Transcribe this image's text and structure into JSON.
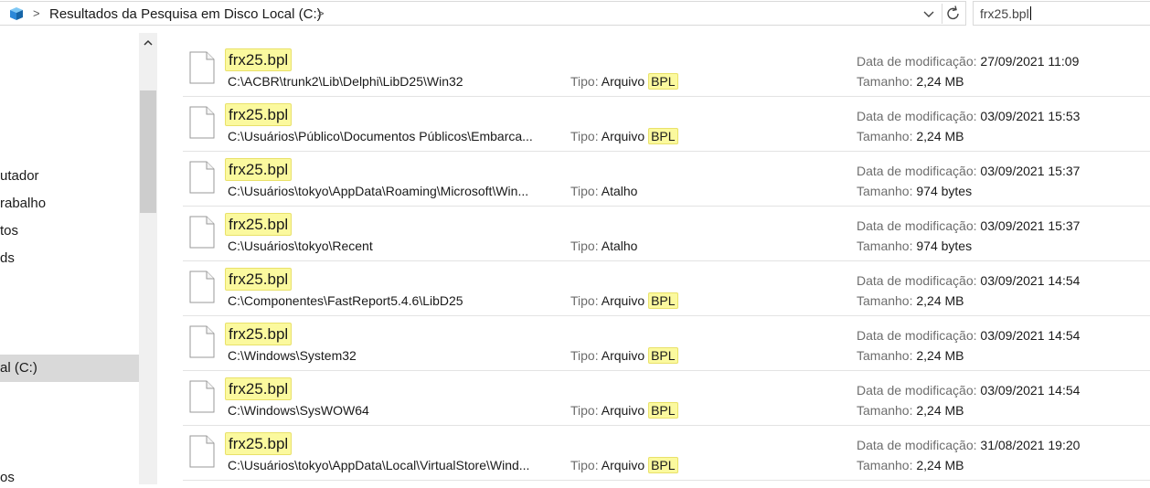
{
  "address_bar": {
    "breadcrumb": "Resultados da Pesquisa em Disco Local (C:)",
    "separator": ">"
  },
  "search": {
    "value": "frx25.bpl"
  },
  "nav": {
    "items": [
      "utador",
      "rabalho",
      "tos",
      "ds",
      "al (C:)",
      "os"
    ]
  },
  "labels": {
    "type": "Tipo:",
    "modified": "Data de modificação:",
    "size": "Tamanho:"
  },
  "results": [
    {
      "name": "frx25.bpl",
      "path": "C:\\ACBR\\trunk2\\Lib\\Delphi\\LibD25\\Win32",
      "type_word": "Arquivo",
      "type_ext": "BPL",
      "modified": "27/09/2021 11:09",
      "size": "2,24 MB"
    },
    {
      "name": "frx25.bpl",
      "path": "C:\\Usuários\\Público\\Documentos Públicos\\Embarca...",
      "type_word": "Arquivo",
      "type_ext": "BPL",
      "modified": "03/09/2021 15:53",
      "size": "2,24 MB"
    },
    {
      "name": "frx25.bpl",
      "path": "C:\\Usuários\\tokyo\\AppData\\Roaming\\Microsoft\\Win...",
      "type_word": "Atalho",
      "type_ext": "",
      "modified": "03/09/2021 15:37",
      "size": "974 bytes"
    },
    {
      "name": "frx25.bpl",
      "path": "C:\\Usuários\\tokyo\\Recent",
      "type_word": "Atalho",
      "type_ext": "",
      "modified": "03/09/2021 15:37",
      "size": "974 bytes"
    },
    {
      "name": "frx25.bpl",
      "path": "C:\\Componentes\\FastReport5.4.6\\LibD25",
      "type_word": "Arquivo",
      "type_ext": "BPL",
      "modified": "03/09/2021 14:54",
      "size": "2,24 MB"
    },
    {
      "name": "frx25.bpl",
      "path": "C:\\Windows\\System32",
      "type_word": "Arquivo",
      "type_ext": "BPL",
      "modified": "03/09/2021 14:54",
      "size": "2,24 MB"
    },
    {
      "name": "frx25.bpl",
      "path": "C:\\Windows\\SysWOW64",
      "type_word": "Arquivo",
      "type_ext": "BPL",
      "modified": "03/09/2021 14:54",
      "size": "2,24 MB"
    },
    {
      "name": "frx25.bpl",
      "path": "C:\\Usuários\\tokyo\\AppData\\Local\\VirtualStore\\Wind...",
      "type_word": "Arquivo",
      "type_ext": "BPL",
      "modified": "31/08/2021 19:20",
      "size": "2,24 MB"
    }
  ]
}
